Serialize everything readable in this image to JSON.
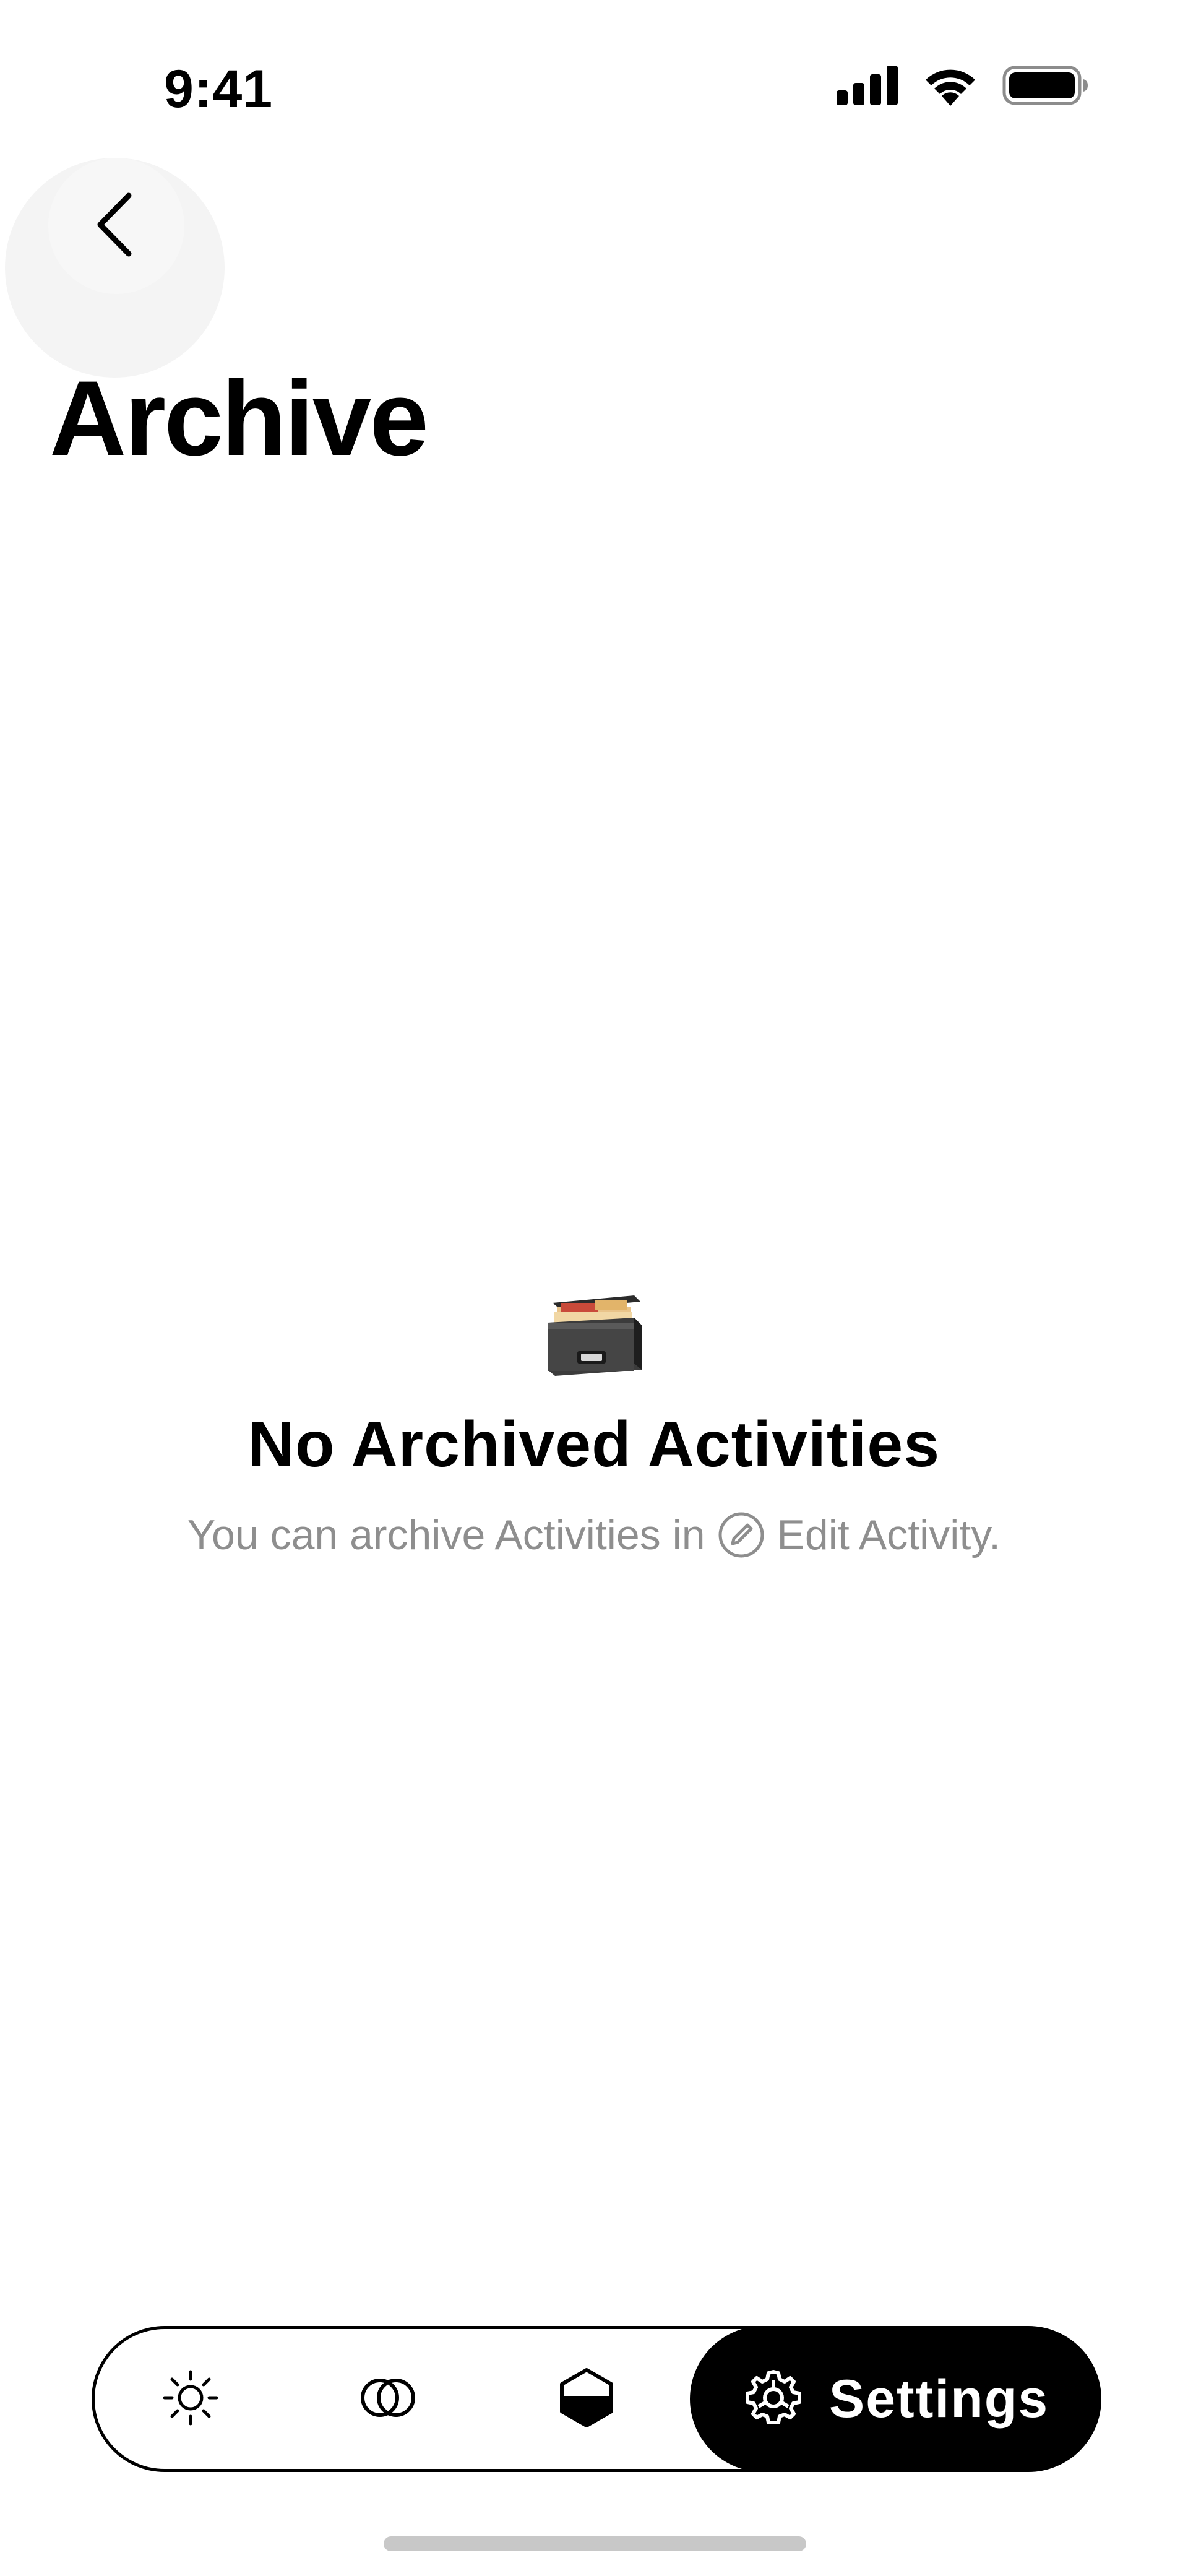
{
  "status_bar": {
    "time": "9:41",
    "icons": [
      "cellular-signal-icon",
      "wifi-icon",
      "battery-icon"
    ]
  },
  "header": {
    "back_icon": "chevron-left-icon",
    "title": "Archive"
  },
  "empty_state": {
    "icon": "card-file-box-icon",
    "title": "No Archived Activities",
    "subtitle_before": "You can archive Activities in",
    "subtitle_icon": "edit-circle-icon",
    "subtitle_after": "Edit Activity."
  },
  "tab_bar": {
    "tabs": [
      {
        "icon": "sun-icon",
        "active": false
      },
      {
        "icon": "overlapping-circles-icon",
        "active": false
      },
      {
        "icon": "hexagon-half-icon",
        "active": false
      },
      {
        "icon": "gear-icon",
        "label": "Settings",
        "active": true
      }
    ]
  },
  "colors": {
    "background": "#ffffff",
    "text": "#000000",
    "secondary_text": "#8e8e8e",
    "active_tab_bg": "#000000",
    "active_tab_text": "#ffffff"
  }
}
